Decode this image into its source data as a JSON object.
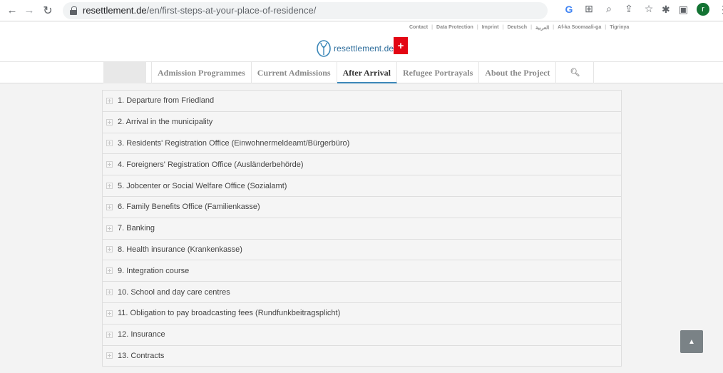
{
  "browser": {
    "url_host": "resettlement.de",
    "url_path": "/en/first-steps-at-your-place-of-residence/",
    "profile_initial": "r"
  },
  "topbar": {
    "links": [
      "Contact",
      "Data Protection",
      "Imprint",
      "Deutsch",
      "العربية",
      "Af-ka Soomaali-ga",
      "Tigrinya"
    ]
  },
  "logo": {
    "text": "resettlement.de"
  },
  "nav": {
    "items": [
      {
        "label": "Admission Programmes",
        "active": false
      },
      {
        "label": "Current Admissions",
        "active": false
      },
      {
        "label": "After Arrival",
        "active": true
      },
      {
        "label": "Refugee Portrayals",
        "active": false
      },
      {
        "label": "About the Project",
        "active": false
      }
    ]
  },
  "accordion": {
    "items": [
      "1. Departure from Friedland",
      "2. Arrival in the municipality",
      "3. Residents' Registration Office (Einwohnermeldeamt/Bürgerbüro)",
      "4. Foreigners' Registration Office (Ausländerbehörde)",
      "5. Jobcenter or Social Welfare Office (Sozialamt)",
      "6. Family Benefits Office (Familienkasse)",
      "7. Banking",
      "8. Health insurance (Krankenkasse)",
      "9. Integration course",
      "10. School and day care centres",
      "11. Obligation to pay broadcasting fees (Rundfunkbeitragsplicht)",
      "12. Insurance",
      "13. Contracts"
    ]
  },
  "colors": {
    "accent": "#3b87b8",
    "caritas": "#e30613",
    "logo_text": "#2f6e9c"
  }
}
